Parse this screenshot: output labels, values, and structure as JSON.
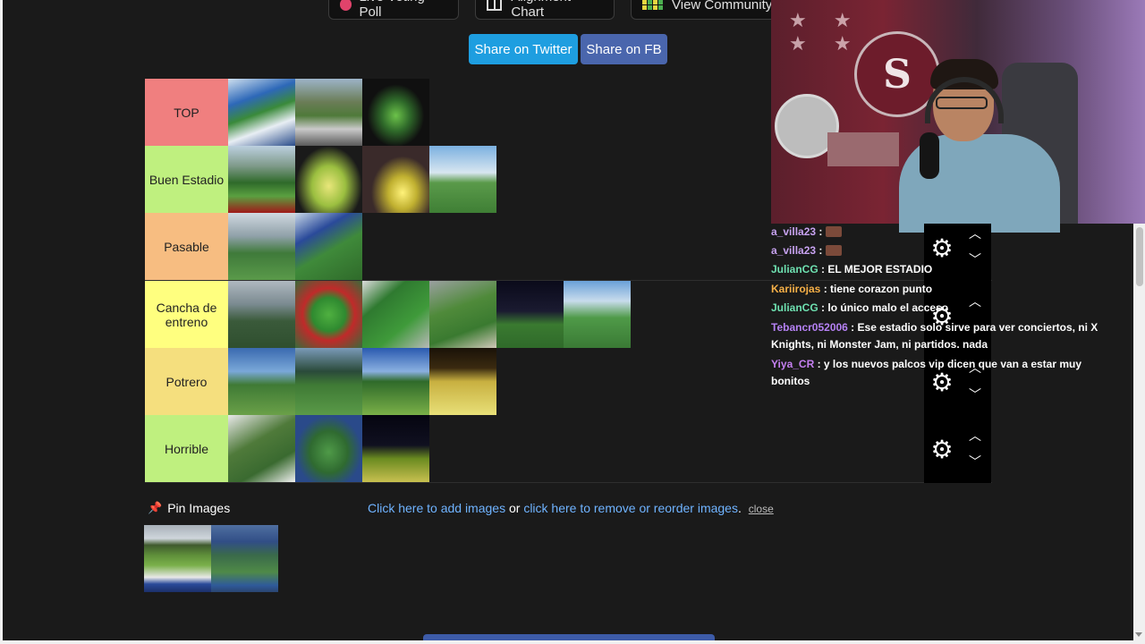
{
  "top_buttons": {
    "live_poll": "Live Voting Poll",
    "alignment": "Alignment Chart",
    "community": "View Community R"
  },
  "share": {
    "twitter": "Share on Twitter",
    "fb": "Share on FB",
    "twitter_color": "#1e9ee0",
    "fb_color": "#4a66ad"
  },
  "tiers": [
    {
      "label": "TOP",
      "color": "#f07f7f",
      "images": [
        "stadium-blue-arena",
        "stadium-hillside",
        "stadium-night-red"
      ]
    },
    {
      "label": "Buen Estadio",
      "color": "#bff07f",
      "images": [
        "field-mountains",
        "stadium-night-lit",
        "stadium-aerial-night",
        "field-daytime"
      ]
    },
    {
      "label": "Pasable",
      "color": "#f7bd81",
      "images": [
        "field-dugout",
        "stadium-sideline"
      ]
    },
    {
      "label": "Cancha de\nentreno",
      "color": "#ffff7f",
      "images": [
        "field-gray-sky",
        "aerial-red-stands",
        "aerial-green",
        "aerial-town",
        "field-floodlights",
        "field-aerial-blue"
      ]
    },
    {
      "label": "Potrero",
      "color": "#f5df7e",
      "images": [
        "field-palms",
        "field-green-stands",
        "field-trees",
        "field-night-yellow"
      ]
    },
    {
      "label": "Horrible",
      "color": "#bff07f",
      "images": [
        "field-aerial-tent",
        "field-aerial-stadium",
        "field-night-lights"
      ]
    }
  ],
  "pin": {
    "label": "Pin Images",
    "images": [
      "pinned-field-stands",
      "pinned-blue-stadium"
    ]
  },
  "add_images": {
    "link1": "Click here to add images",
    "or": " or ",
    "link2": "click here to remove or reorder images",
    "period": ".",
    "close": "close"
  },
  "chat": [
    {
      "user": "a_villa23",
      "color": "#c7a2f0",
      "text": "",
      "emote": true
    },
    {
      "user": "a_villa23",
      "color": "#c7a2f0",
      "text": "",
      "emote": true
    },
    {
      "user": "JulianCG",
      "color": "#6ee0b0",
      "text": "EL MEJOR ESTADIO"
    },
    {
      "user": "Kariirojas",
      "color": "#f6b047",
      "text": "tiene corazon punto"
    },
    {
      "user": "JulianCG",
      "color": "#6ee0b0",
      "text": "lo único malo el acceso"
    },
    {
      "user": "Tebancr052006",
      "color": "#b581f4",
      "text": "Ese estadio solo sirve para ver conciertos, ni X Knights, ni Monster Jam, ni partidos. nada"
    },
    {
      "user": "Yiya_CR",
      "color": "#c47ff0",
      "text": "y los nuevos palcos vip dicen que van a estar muy bonitos"
    }
  ],
  "stream": {
    "badge_letter": "S"
  }
}
